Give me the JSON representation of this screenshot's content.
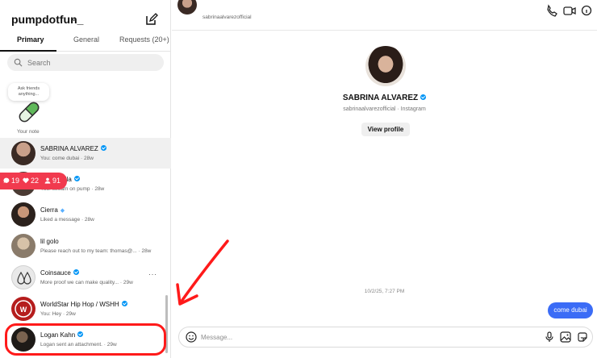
{
  "account": {
    "username": "pumpdotfun_",
    "chevron": "⌄"
  },
  "tabs": [
    {
      "label": "Primary"
    },
    {
      "label": "General"
    },
    {
      "label": "Requests (20+)"
    }
  ],
  "search": {
    "placeholder": "Search"
  },
  "note": {
    "bubble": "Ask friends anything...",
    "label": "Your note"
  },
  "notifications": {
    "comments": "19",
    "likes": "22",
    "followers": "91"
  },
  "conversations": [
    {
      "name": "SABRINA ALVAREZ",
      "verified": true,
      "preview": "You: come dubai · 28w"
    },
    {
      "name": "illa",
      "verified": true,
      "preview": "You: stream on pump · 28w"
    },
    {
      "name": "Cierra",
      "verified": false,
      "preview": "Liked a message · 28w"
    },
    {
      "name": "lil golo",
      "verified": false,
      "preview": "Please reach out to my team: thomas@... · 28w"
    },
    {
      "name": "Coinsauce",
      "verified": true,
      "preview": "More proof we can make quality... · 29w",
      "more": "···"
    },
    {
      "name": "WorldStar Hip Hop / WSHH",
      "verified": true,
      "preview": "You: Hey · 29w"
    },
    {
      "name": "Logan Kahn",
      "verified": true,
      "preview": "Logan sent an attachment. · 29w"
    }
  ],
  "chat": {
    "header_username": "sabrinaalvarezofficial",
    "profile_name": "SABRINA ALVAREZ",
    "profile_sub": "sabrinaalvarezofficial · Instagram",
    "view_profile": "View profile",
    "timestamp": "10/2/25, 7:27 PM",
    "outgoing_message": "come dubai",
    "composer_placeholder": "Message..."
  },
  "colors": {
    "accent": "#0095f6",
    "bubble": "#3b6cf6",
    "notif": "#f13a4e",
    "annotation": "#ff1a1a"
  },
  "icons": [
    "compose-icon",
    "search-icon",
    "pill-icon",
    "comment-icon",
    "heart-icon",
    "person-icon",
    "emoji-icon",
    "mic-icon",
    "image-icon",
    "sticker-icon"
  ]
}
